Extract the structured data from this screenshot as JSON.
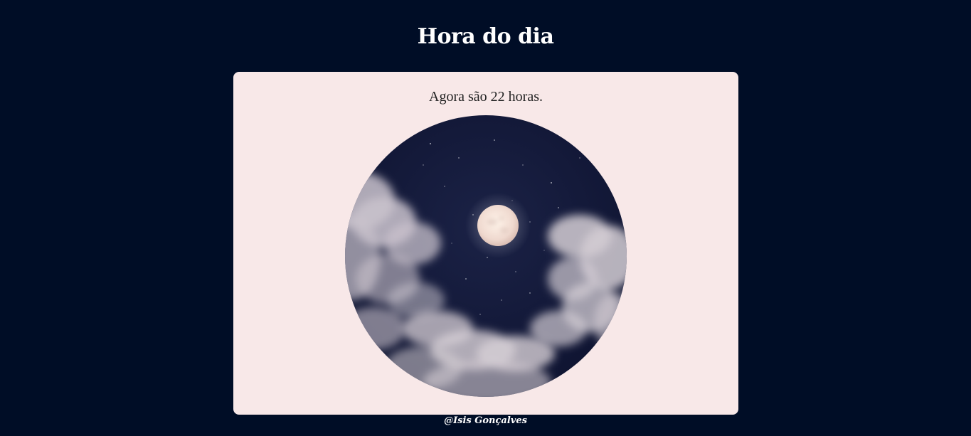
{
  "header": {
    "title": "Hora do dia"
  },
  "card": {
    "message": "Agora são 22 horas.",
    "image": {
      "subject": "night-sky-moon-image"
    }
  },
  "footer": {
    "credit": "@Isis Gonçalves"
  },
  "colors": {
    "page_background": "#000d26",
    "card_background": "#f8e8e8",
    "title_text": "#ffffff",
    "message_text": "#222222",
    "sky": "#141a38"
  }
}
